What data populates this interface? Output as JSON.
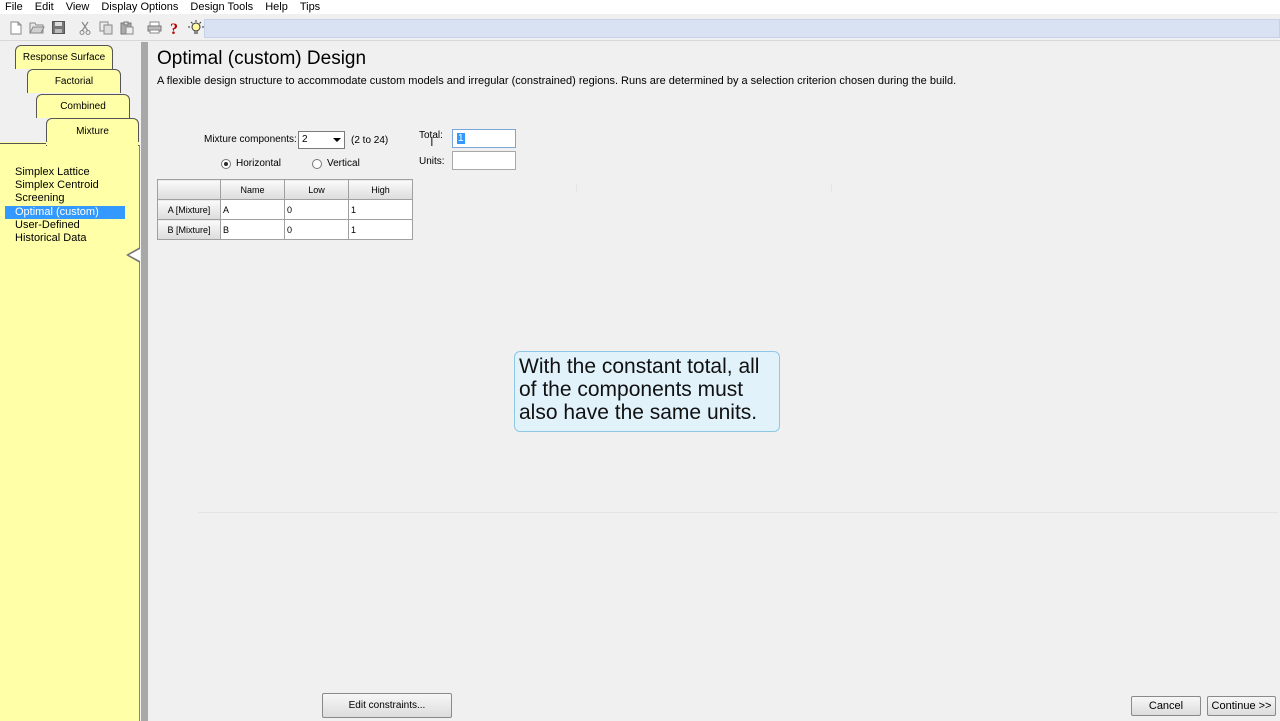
{
  "menu": [
    "File",
    "Edit",
    "View",
    "Display Options",
    "Design Tools",
    "Help",
    "Tips"
  ],
  "toolbar": {
    "icons": [
      "new-file-icon",
      "open-folder-icon",
      "save-icon",
      "cut-icon",
      "copy-icon",
      "paste-icon",
      "print-icon",
      "help-icon",
      "tip-lightbulb-icon"
    ]
  },
  "tabs": [
    "Response Surface",
    "Factorial",
    "Combined",
    "Mixture"
  ],
  "design_list": [
    "Simplex Lattice",
    "Simplex Centroid",
    "Screening",
    "Optimal (custom)",
    "User-Defined",
    "Historical Data"
  ],
  "design_list_selected": "Optimal (custom)",
  "main": {
    "title": "Optimal (custom) Design",
    "description": "A flexible design structure to accommodate custom models and irregular (constrained) regions.  Runs are determined by a selection criterion chosen during the build."
  },
  "form": {
    "components_label": "Mixture components:",
    "components_value": "2",
    "components_range": "(2 to 24)",
    "radio_horizontal": "Horizontal",
    "radio_vertical": "Vertical",
    "radio_selected": "Horizontal",
    "total_label": "Total:",
    "total_value": "1",
    "units_label": "Units:",
    "units_value": ""
  },
  "table": {
    "headers": [
      "Name",
      "Low",
      "High"
    ],
    "rows": [
      {
        "label": "A [Mixture]",
        "name": "A",
        "low": "0",
        "high": "1"
      },
      {
        "label": "B [Mixture]",
        "name": "B",
        "low": "0",
        "high": "1"
      }
    ]
  },
  "callout": {
    "text": "With the constant total, all of the components must also have the same units."
  },
  "buttons": {
    "edit_constraints": "Edit constraints...",
    "cancel": "Cancel",
    "continue": "Continue >>"
  }
}
